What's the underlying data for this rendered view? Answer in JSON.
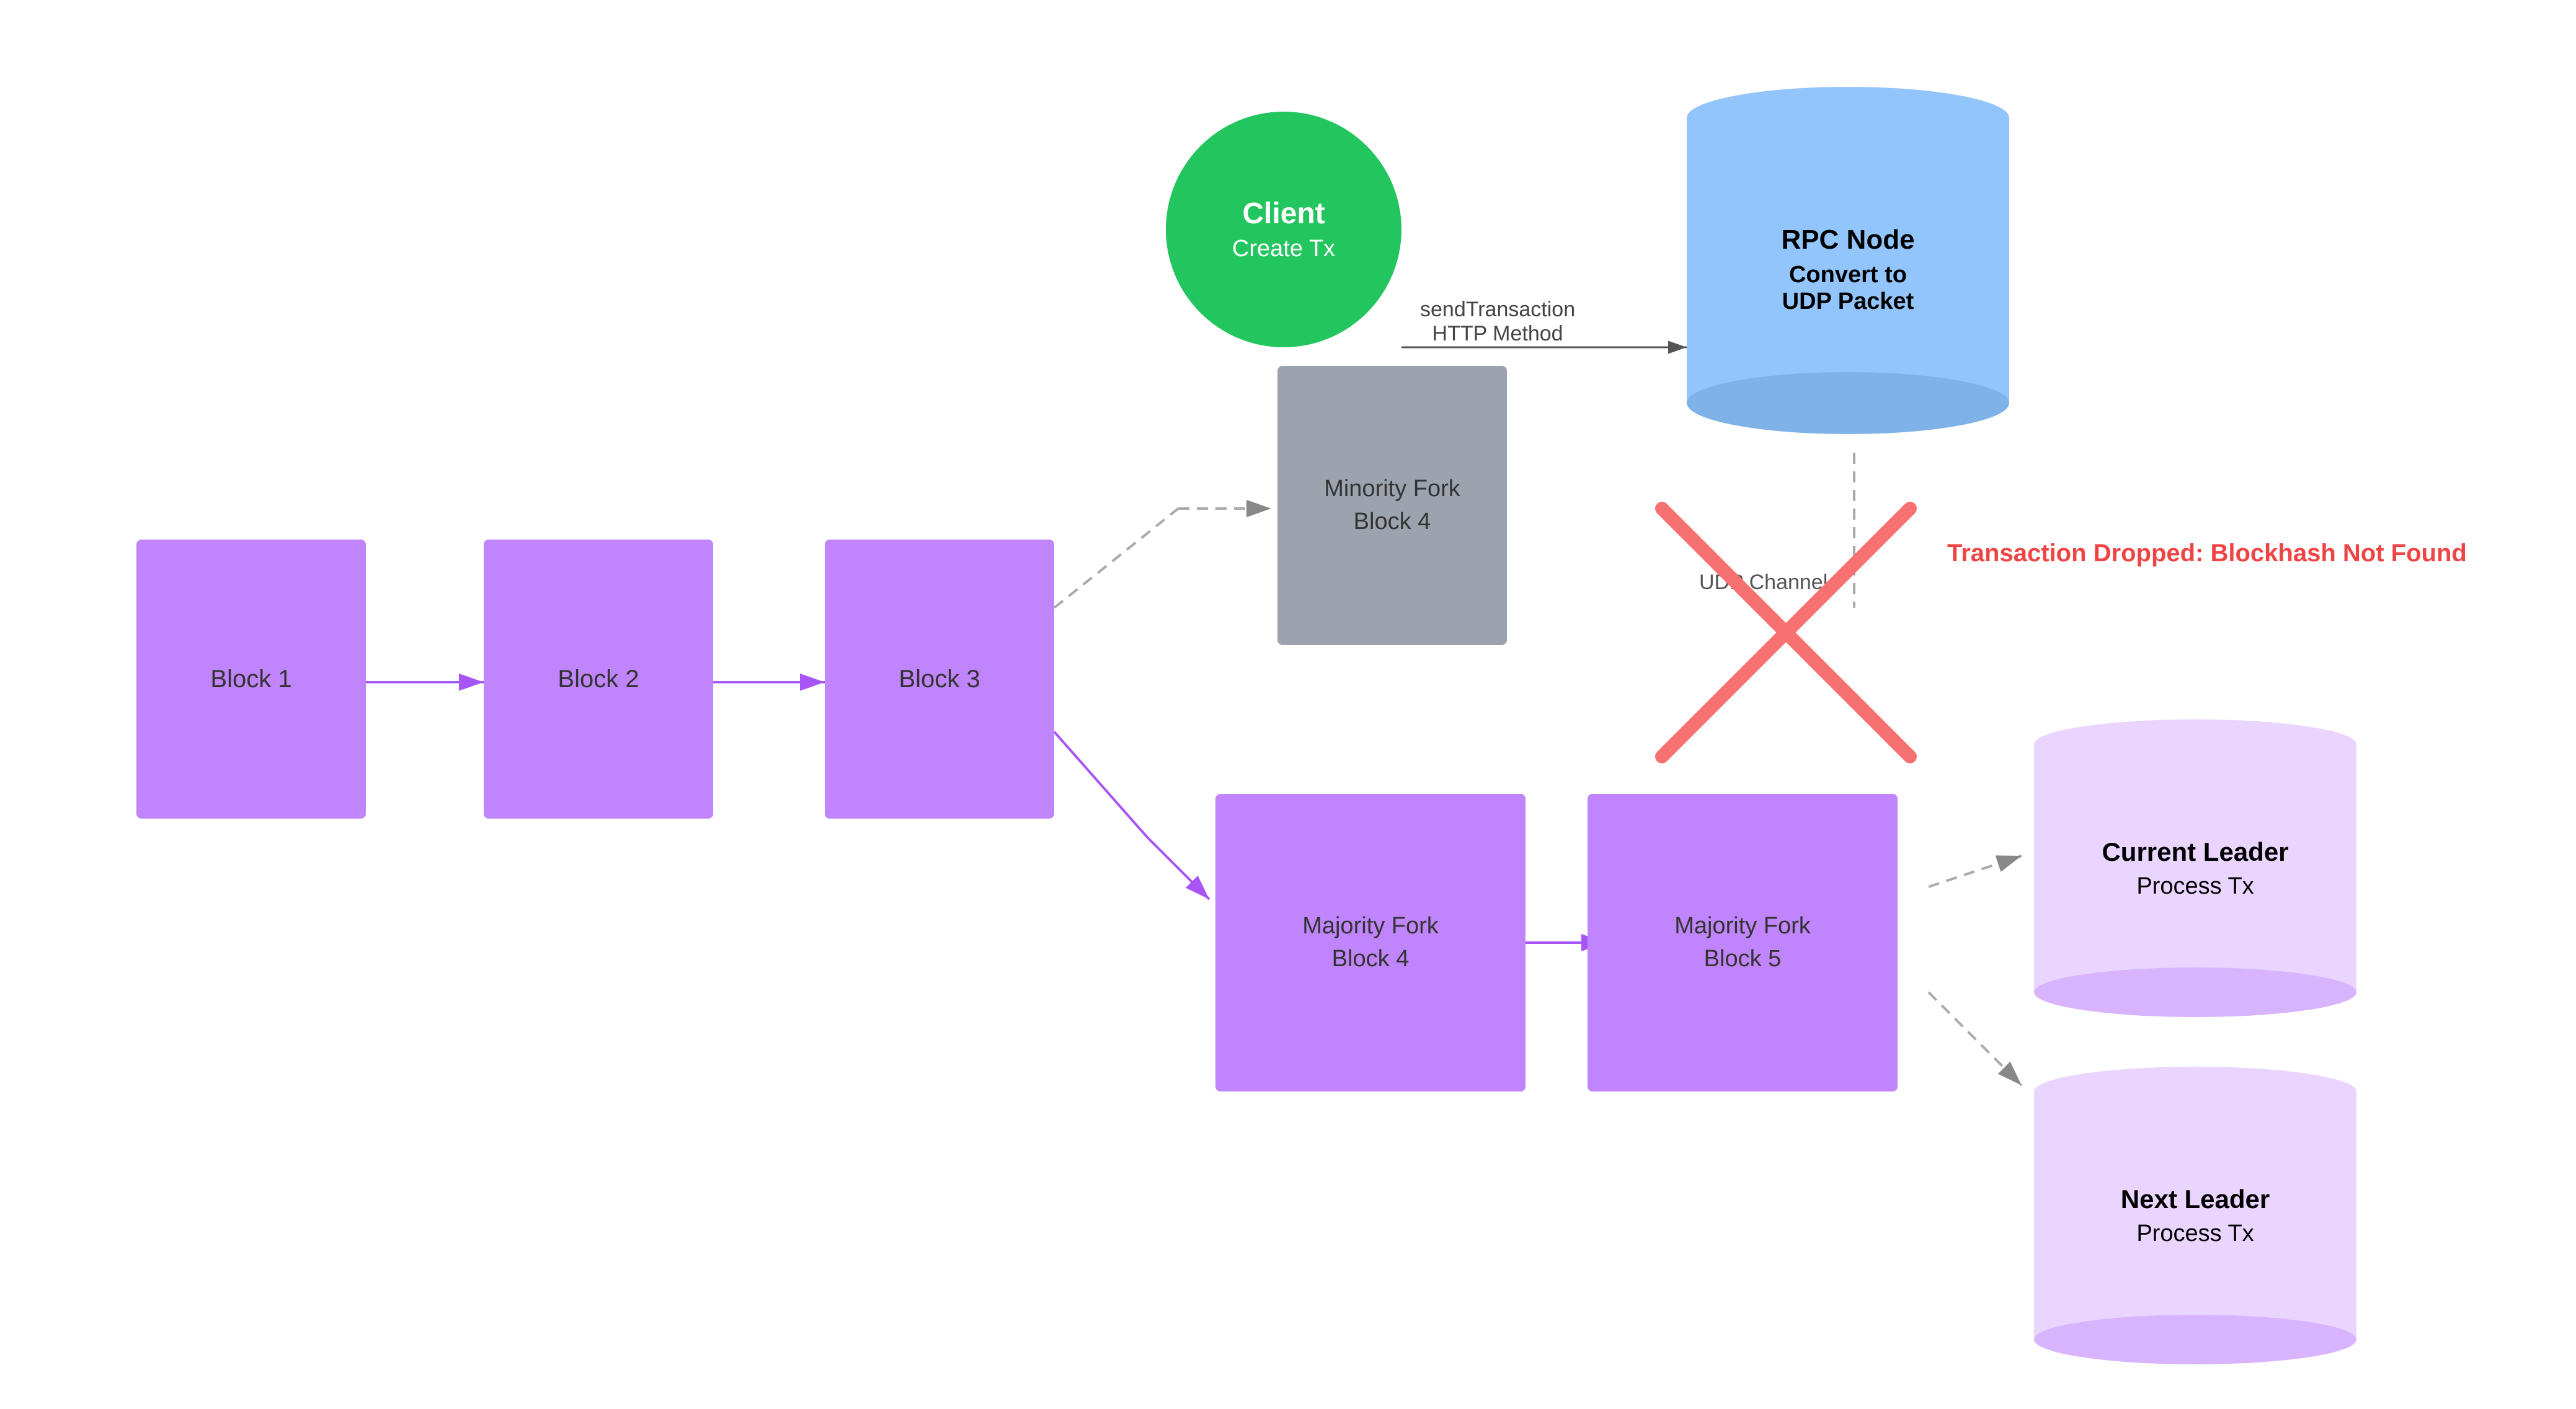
{
  "blocks": {
    "block1": {
      "label": "Block 1"
    },
    "block2": {
      "label": "Block 2"
    },
    "block3": {
      "label": "Block 3"
    },
    "minority_fork_block4": {
      "label": "Minority Fork\nBlock 4"
    },
    "majority_fork_block4": {
      "label": "Majority Fork\nBlock 4"
    },
    "majority_fork_block5": {
      "label": "Majority Fork\nBlock 5"
    }
  },
  "client": {
    "title": "Client",
    "subtitle": "Create Tx"
  },
  "rpc_node": {
    "title": "RPC Node",
    "subtitle": "Convert to\nUDP Packet"
  },
  "current_leader": {
    "title": "Current Leader",
    "subtitle": "Process Tx"
  },
  "next_leader": {
    "title": "Next Leader",
    "subtitle": "Process Tx"
  },
  "labels": {
    "send_transaction": "sendTransaction\nHTTP Method",
    "udp_channel": "UDP Channel",
    "error": "Transaction Dropped: Blockhash Not Found"
  }
}
